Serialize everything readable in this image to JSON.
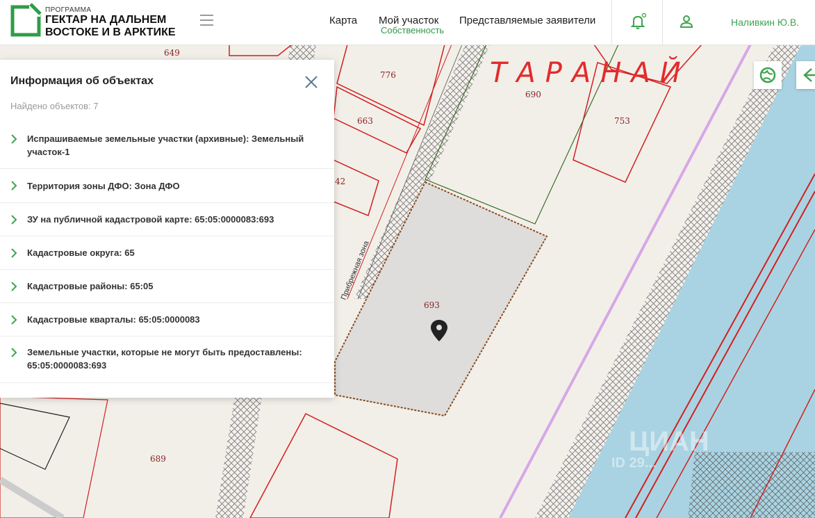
{
  "header": {
    "logo_small": "ПРОГРАММА",
    "logo_line1": "ГЕКТАР НА ДАЛЬНЕМ",
    "logo_line2": "ВОСТОКЕ И В АРКТИКЕ",
    "nav": [
      {
        "label": "Карта"
      },
      {
        "label": "Мой участок",
        "sub": "Собственность"
      },
      {
        "label": "Представляемые заявители"
      }
    ],
    "user_name": "Наливкин Ю.В."
  },
  "panel": {
    "title": "Информация об объектах",
    "count": "Найдено объектов: 7",
    "items": [
      {
        "text": "Испрашиваемые земельные участки (архивные): Земельный участок-1"
      },
      {
        "text": "Территория зоны ДФО: Зона ДФО"
      },
      {
        "text": "ЗУ на публичной кадастровой карте: 65:05:0000083:693"
      },
      {
        "text": "Кадастровые округа: 65"
      },
      {
        "text": "Кадастровые районы: 65:05"
      },
      {
        "text": "Кадастровые кварталы: 65:05:0000083"
      },
      {
        "text": "Земельные участки, которые не могут быть предоставлены: 65:05:0000083:693"
      }
    ]
  },
  "map": {
    "parcel_labels": [
      "649",
      "776",
      "690",
      "663",
      "753",
      "42",
      "693",
      "689"
    ],
    "zone_label": "Прибрежная зона",
    "handwritten": "ТАРАНАЙ",
    "watermark": "ЦИАН",
    "watermark_id": "ID 29..."
  },
  "colors": {
    "brand_green": "#3ea34f",
    "parcel_red": "#d21f1f",
    "water_blue": "#a9d3e2",
    "selected_parcel": "#dedddb"
  },
  "icons": [
    "logo-icon",
    "menu-icon",
    "bell-icon",
    "user-icon",
    "close-icon",
    "chevron-right-icon",
    "map-pin-icon",
    "globe-icon",
    "back-arrow-icon"
  ]
}
